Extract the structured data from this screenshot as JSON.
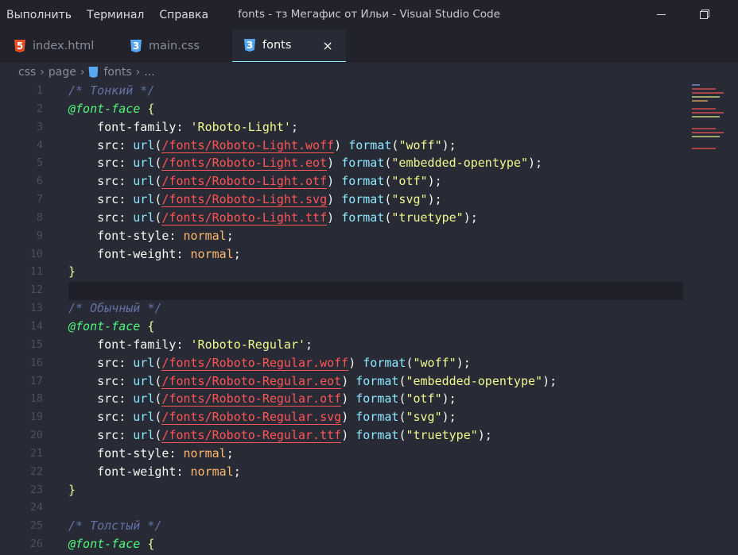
{
  "window": {
    "title": "fonts - тз Мегафис от Ильи - Visual Studio Code",
    "menu": [
      "Выполнить",
      "Терминал",
      "Справка"
    ]
  },
  "tabs": [
    {
      "label": "index.html",
      "icon": "html-file-icon",
      "active": false
    },
    {
      "label": "main.css",
      "icon": "css-file-icon",
      "active": false
    },
    {
      "label": "fonts",
      "icon": "css-file-icon",
      "active": true,
      "close": "×"
    }
  ],
  "breadcrumb": [
    "css",
    "page",
    "fonts",
    "..."
  ],
  "editor": {
    "line_numbers": [
      "1",
      "2",
      "3",
      "4",
      "5",
      "6",
      "7",
      "8",
      "9",
      "10",
      "11",
      "12",
      "13",
      "14",
      "15",
      "16",
      "17",
      "18",
      "19",
      "20",
      "21",
      "22",
      "23",
      "24",
      "25",
      "26"
    ],
    "lines": [
      "/* Тонкий */",
      "@font-face {",
      "  font-family: 'Roboto-Light';",
      "  src: url(/fonts/Roboto-Light.woff) format(\"woff\");",
      "  src: url(/fonts/Roboto-Light.eot) format(\"embedded-opentype\");",
      "  src: url(/fonts/Roboto-Light.otf) format(\"otf\");",
      "  src: url(/fonts/Roboto-Light.svg) format(\"svg\");",
      "  src: url(/fonts/Roboto-Light.ttf) format(\"truetype\");",
      "  font-style: normal;",
      "  font-weight: normal;",
      "}",
      "",
      "/* Обычный */",
      "@font-face {",
      "  font-family: 'Roboto-Regular';",
      "  src: url(/fonts/Roboto-Regular.woff) format(\"woff\");",
      "  src: url(/fonts/Roboto-Regular.eot) format(\"embedded-opentype\");",
      "  src: url(/fonts/Roboto-Regular.otf) format(\"otf\");",
      "  src: url(/fonts/Roboto-Regular.svg) format(\"svg\");",
      "  src: url(/fonts/Roboto-Regular.ttf) format(\"truetype\");",
      "  font-style: normal;",
      "  font-weight: normal;",
      "}",
      "",
      "/* Толстый */",
      "@font-face {"
    ]
  },
  "colors": {
    "background": "#282a36",
    "comment": "#6272a4",
    "at_rule": "#50fa7b",
    "string": "#f1fa8c",
    "function": "#8be9fd",
    "path": "#ff5555",
    "keyword": "#ffb86c"
  }
}
